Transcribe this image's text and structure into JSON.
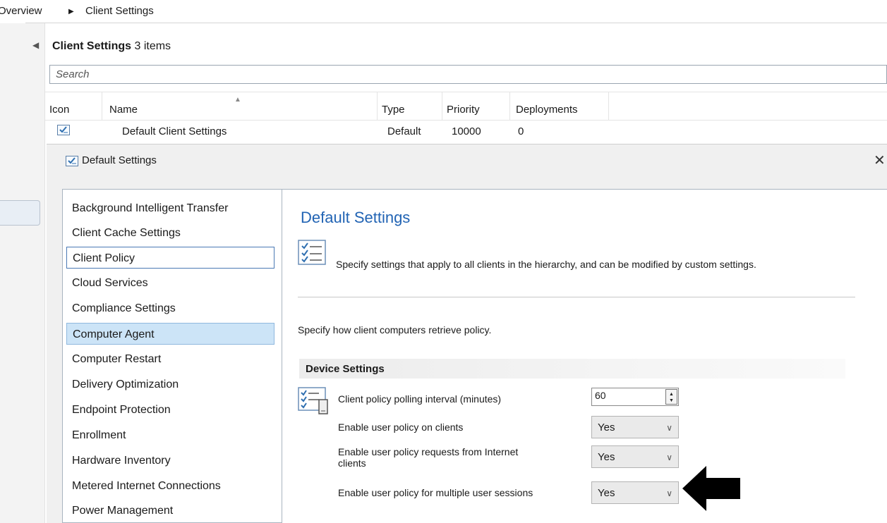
{
  "breadcrumb": {
    "overview": "Overview",
    "separator": "▶",
    "current": "Client Settings"
  },
  "list": {
    "title": "Client Settings",
    "count": "3 items",
    "search_placeholder": "Search",
    "columns": [
      "Icon",
      "Name",
      "Type",
      "Priority",
      "Deployments"
    ],
    "rows": [
      {
        "name": "Default Client Settings",
        "type": "Default",
        "priority": "10000",
        "deployments": "0"
      }
    ]
  },
  "dialog": {
    "title": "Default Settings",
    "nav_items": [
      "Background Intelligent Transfer",
      "Client Cache Settings",
      "Client Policy",
      "Cloud Services",
      "Compliance Settings",
      "Computer Agent",
      "Computer Restart",
      "Delivery Optimization",
      "Endpoint Protection",
      "Enrollment",
      "Hardware Inventory",
      "Metered Internet Connections",
      "Power Management"
    ],
    "focused_item": "Client Policy",
    "selected_item": "Computer Agent",
    "content": {
      "title": "Default Settings",
      "description": "Specify settings that apply to all clients in the hierarchy, and can be modified by custom settings.",
      "policy_description": "Specify how client computers retrieve policy.",
      "section_header": "Device Settings",
      "settings": [
        {
          "label": "Client policy polling interval (minutes)",
          "value": "60"
        },
        {
          "label": "Enable user policy on clients",
          "value": "Yes"
        },
        {
          "label_line1": "Enable user policy requests from Internet",
          "label_line2": "clients",
          "value": "Yes"
        },
        {
          "label": "Enable user policy for multiple user sessions",
          "value": "Yes"
        }
      ]
    }
  },
  "icons": {
    "collapse": "chevron-left-icon",
    "close": "close-icon",
    "dropdown": "chevron-down-icon"
  },
  "colors": {
    "accent": "#2264b4",
    "selection": "#cce4f7",
    "focus_border": "#4a79b4"
  }
}
